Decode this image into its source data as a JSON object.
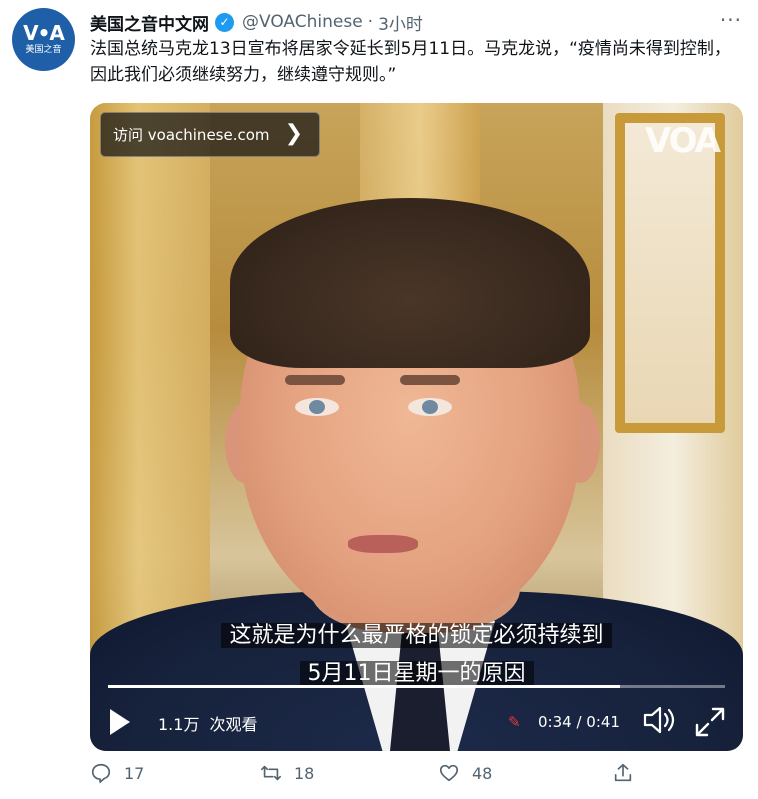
{
  "account": {
    "avatar_logo": "V•A",
    "avatar_sub": "美国之音",
    "name": "美国之音中文网",
    "handle": "@VOAChinese",
    "dot": "·",
    "time": "3小时"
  },
  "more_label": "···",
  "tweet_text": "法国总统马克龙13日宣布将居家令延长到5月11日。马克龙说，“疫情尚未得到控制，因此我们必须继续努力，继续遵守规则。”",
  "media": {
    "visit_label": "访问 voachinese.com",
    "visit_chevron": "❯",
    "watermark": "VOA",
    "subtitle_line1": "这就是为什么最严格的锁定必须持续到",
    "subtitle_line2": "5月11日星期一的原因",
    "progress_fraction": 0.83,
    "views_count": "1.1万",
    "views_label": "次观看",
    "clip_glyph": "✎",
    "time_display": "0:34 / 0:41"
  },
  "actions": {
    "reply_count": "17",
    "retweet_count": "18",
    "like_count": "48"
  },
  "icons": [
    "verified-icon",
    "more-icon",
    "chevron-right-icon",
    "play-icon",
    "volume-icon",
    "fullscreen-icon",
    "reply-icon",
    "retweet-icon",
    "like-icon",
    "share-icon"
  ],
  "colors": {
    "verified": "#1d9bf0",
    "muted": "#536471",
    "avatar_bg": "#1f5fa8"
  }
}
